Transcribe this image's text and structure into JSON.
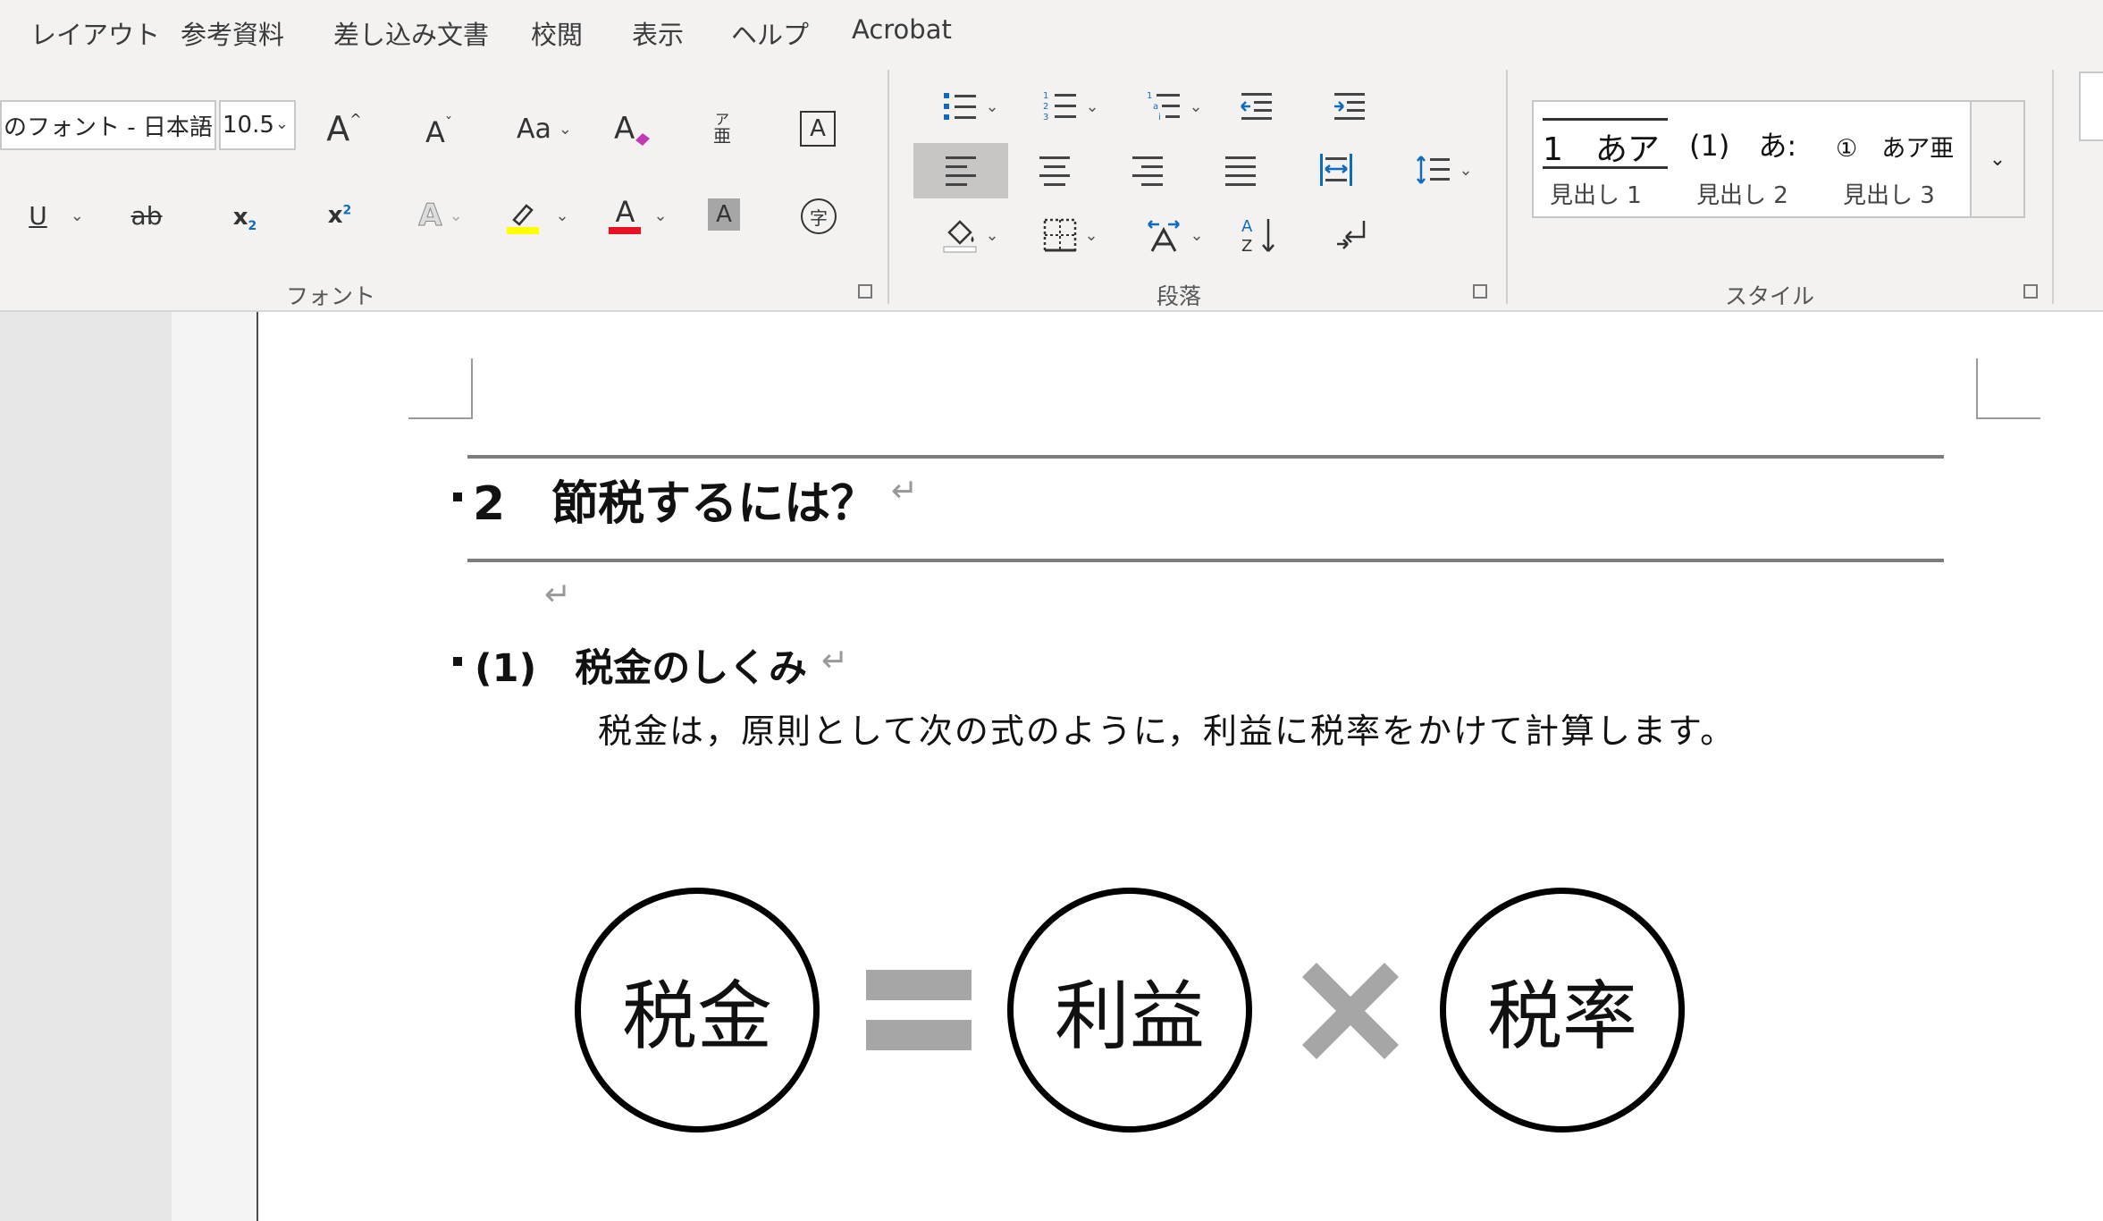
{
  "tabs": [
    "レイアウト",
    "参考資料",
    "差し込み文書",
    "校閲",
    "表示",
    "ヘルプ",
    "Acrobat"
  ],
  "font": {
    "name": "のフォント - 日本語)",
    "size": "10.5",
    "grow_label": "A",
    "shrink_label": "A",
    "case_label": "Aa",
    "phonetic_top": "ア",
    "phonetic_bottom": "亜",
    "border_char": "A",
    "underline": "U",
    "strike": "ab",
    "subscript": "x",
    "subscript_sub": "2",
    "superscript": "x",
    "superscript_sup": "2",
    "effects": "A",
    "font_color": "A",
    "shading": "A",
    "enclose": "字",
    "highlight_color": "#ffff00",
    "font_color_value": "#e81123"
  },
  "groups": {
    "font": "フォント",
    "paragraph": "段落",
    "styles": "スタイル"
  },
  "paragraph": {
    "sort_a": "A",
    "sort_z": "Z"
  },
  "styles": [
    {
      "preview": "1　あア",
      "name": "見出し 1"
    },
    {
      "preview": "(1)　あ:",
      "name": "見出し 2"
    },
    {
      "preview": "①　あア亜",
      "name": "見出し 3"
    }
  ],
  "document": {
    "heading2": "2　節税するには？",
    "heading3": "(1)　税金のしくみ",
    "body": "税金は，原則として次の式のように，利益に税率をかけて計算します。",
    "return_mark": "↵",
    "formula": {
      "tax": "税金",
      "profit": "利益",
      "rate": "税率"
    }
  },
  "colors": {
    "operator_gray": "#a6a6a6",
    "highlight_yellow": "#ffff00",
    "font_red": "#e81123",
    "accent_blue": "#0f6cbd"
  }
}
